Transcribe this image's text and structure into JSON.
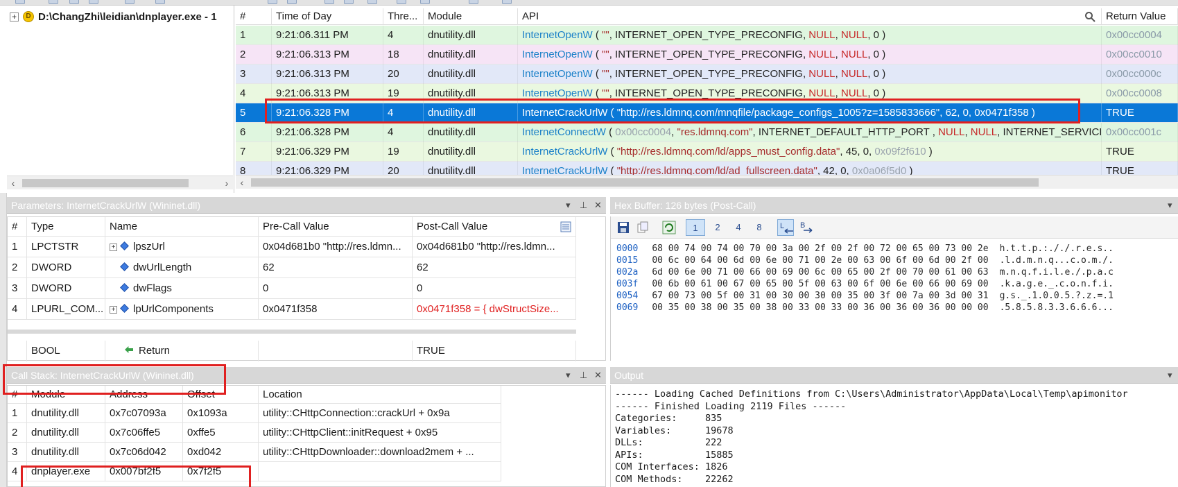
{
  "process_tree": {
    "expander": "+",
    "process_path": "D:\\ChangZhi\\leidian\\dnplayer.exe - 1"
  },
  "api_grid": {
    "columns": [
      "#",
      "Time of Day",
      "Thre...",
      "Module",
      "API",
      "Return Value"
    ],
    "rows": [
      {
        "num": "1",
        "time": "9:21:06.311 PM",
        "thread": "4",
        "module": "dnutility.dll",
        "api_fn": "InternetOpenW",
        "args": [
          [
            "c-const",
            " ( "
          ],
          [
            "c-str",
            "\"\""
          ],
          [
            "c-const",
            ", INTERNET_OPEN_TYPE_PRECONFIG, "
          ],
          [
            "c-null",
            "NULL"
          ],
          [
            "c-const",
            ", "
          ],
          [
            "c-null",
            "NULL"
          ],
          [
            "c-const",
            ", 0 )"
          ]
        ],
        "ret": "0x00cc0004",
        "bg": "#dff6df",
        "ret_dim": true
      },
      {
        "num": "2",
        "time": "9:21:06.313 PM",
        "thread": "18",
        "module": "dnutility.dll",
        "api_fn": "InternetOpenW",
        "args": [
          [
            "c-const",
            " ( "
          ],
          [
            "c-str",
            "\"\""
          ],
          [
            "c-const",
            ", INTERNET_OPEN_TYPE_PRECONFIG, "
          ],
          [
            "c-null",
            "NULL"
          ],
          [
            "c-const",
            ", "
          ],
          [
            "c-null",
            "NULL"
          ],
          [
            "c-const",
            ", 0 )"
          ]
        ],
        "ret": "0x00cc0010",
        "bg": "#f6e4f6",
        "ret_dim": true
      },
      {
        "num": "3",
        "time": "9:21:06.313 PM",
        "thread": "20",
        "module": "dnutility.dll",
        "api_fn": "InternetOpenW",
        "args": [
          [
            "c-const",
            " ( "
          ],
          [
            "c-str",
            "\"\""
          ],
          [
            "c-const",
            ", INTERNET_OPEN_TYPE_PRECONFIG, "
          ],
          [
            "c-null",
            "NULL"
          ],
          [
            "c-const",
            ", "
          ],
          [
            "c-null",
            "NULL"
          ],
          [
            "c-const",
            ", 0 )"
          ]
        ],
        "ret": "0x00cc000c",
        "bg": "#e2e8f8",
        "ret_dim": true
      },
      {
        "num": "4",
        "time": "9:21:06.313 PM",
        "thread": "19",
        "module": "dnutility.dll",
        "api_fn": "InternetOpenW",
        "args": [
          [
            "c-const",
            " ( "
          ],
          [
            "c-str",
            "\"\""
          ],
          [
            "c-const",
            ", INTERNET_OPEN_TYPE_PRECONFIG, "
          ],
          [
            "c-null",
            "NULL"
          ],
          [
            "c-const",
            ", "
          ],
          [
            "c-null",
            "NULL"
          ],
          [
            "c-const",
            ", 0 )"
          ]
        ],
        "ret": "0x00cc0008",
        "bg": "#eaf8e0",
        "ret_dim": true
      },
      {
        "num": "5",
        "time": "9:21:06.328 PM",
        "thread": "4",
        "module": "dnutility.dll",
        "api_fn": "InternetCrackUrlW",
        "args": [
          [
            "c-const",
            " ( \"http://res.ldmnq.com/mnqfile/package_configs_1005?z=1585833666\", 62, 0, 0x0471f358 )"
          ]
        ],
        "ret": "TRUE",
        "bg": "#0a78d7",
        "selected": true
      },
      {
        "num": "6",
        "time": "9:21:06.328 PM",
        "thread": "4",
        "module": "dnutility.dll",
        "api_fn": "InternetConnectW",
        "args": [
          [
            "c-const",
            " ( "
          ],
          [
            "c-num",
            "0x00cc0004"
          ],
          [
            "c-const",
            ", "
          ],
          [
            "c-str",
            "\"res.ldmnq.com\""
          ],
          [
            "c-const",
            ", INTERNET_DEFAULT_HTTP_PORT , "
          ],
          [
            "c-null",
            "NULL"
          ],
          [
            "c-const",
            ", "
          ],
          [
            "c-null",
            "NULL"
          ],
          [
            "c-const",
            ", INTERNET_SERVICE_H..."
          ]
        ],
        "ret": "0x00cc001c",
        "bg": "#dff6df",
        "ret_dim": true
      },
      {
        "num": "7",
        "time": "9:21:06.329 PM",
        "thread": "19",
        "module": "dnutility.dll",
        "api_fn": "InternetCrackUrlW",
        "args": [
          [
            "c-const",
            " ( "
          ],
          [
            "c-str",
            "\"http://res.ldmnq.com/ld/apps_must_config.data\""
          ],
          [
            "c-const",
            ", 45, 0, "
          ],
          [
            "c-num",
            "0x09f2f610"
          ],
          [
            "c-const",
            " )"
          ]
        ],
        "ret": "TRUE",
        "bg": "#eaf8e0"
      },
      {
        "num": "8",
        "time": "9:21:06.329 PM",
        "thread": "20",
        "module": "dnutility.dll",
        "api_fn": "InternetCrackUrlW",
        "args": [
          [
            "c-const",
            " ( "
          ],
          [
            "c-str",
            "\"http://res.ldmnq.com/ld/ad_fullscreen.data\""
          ],
          [
            "c-const",
            ", 42, 0, "
          ],
          [
            "c-num",
            "0x0a06f5d0"
          ],
          [
            "c-const",
            " )"
          ]
        ],
        "ret": "TRUE",
        "bg": "#e2e8f8"
      }
    ]
  },
  "params": {
    "title": "Parameters: InternetCrackUrlW (Wininet.dll)",
    "columns": [
      "#",
      "Type",
      "Name",
      "Pre-Call Value",
      "Post-Call Value"
    ],
    "rows": [
      {
        "num": "1",
        "type": "LPCTSTR",
        "name": "lpszUrl",
        "expand": true,
        "pre": "0x04d681b0 \"http://res.ldmn...",
        "post": "0x04d681b0 \"http://res.ldmn...",
        "post_red": false
      },
      {
        "num": "2",
        "type": "DWORD",
        "name": "dwUrlLength",
        "expand": false,
        "pre": "62",
        "post": "62",
        "post_red": false
      },
      {
        "num": "3",
        "type": "DWORD",
        "name": "dwFlags",
        "expand": false,
        "pre": "0",
        "post": "0",
        "post_red": false
      },
      {
        "num": "4",
        "type": "LPURL_COM...",
        "name": "lpUrlComponents",
        "expand": true,
        "pre": "0x0471f358",
        "post": "0x0471f358 = { dwStructSize...",
        "post_red": true
      }
    ],
    "return_row": {
      "type": "BOOL",
      "name": "Return",
      "post": "TRUE"
    }
  },
  "hex": {
    "title": "Hex Buffer: 126 bytes (Post-Call)",
    "tool_labels": [
      "1",
      "2",
      "4",
      "8"
    ],
    "lines": [
      {
        "off": "0000",
        "bytes": "68 00 74 00 74 00 70 00 3a 00 2f 00 2f 00 72 00 65 00 73 00 2e",
        "ascii": "h.t.t.p.:././.r.e.s.."
      },
      {
        "off": "0015",
        "bytes": "00 6c 00 64 00 6d 00 6e 00 71 00 2e 00 63 00 6f 00 6d 00 2f 00",
        "ascii": ".l.d.m.n.q...c.o.m./."
      },
      {
        "off": "002a",
        "bytes": "6d 00 6e 00 71 00 66 00 69 00 6c 00 65 00 2f 00 70 00 61 00 63",
        "ascii": "m.n.q.f.i.l.e./.p.a.c"
      },
      {
        "off": "003f",
        "bytes": "00 6b 00 61 00 67 00 65 00 5f 00 63 00 6f 00 6e 00 66 00 69 00",
        "ascii": ".k.a.g.e._.c.o.n.f.i."
      },
      {
        "off": "0054",
        "bytes": "67 00 73 00 5f 00 31 00 30 00 30 00 35 00 3f 00 7a 00 3d 00 31",
        "ascii": "g.s._.1.0.0.5.?.z.=.1"
      },
      {
        "off": "0069",
        "bytes": "00 35 00 38 00 35 00 38 00 33 00 33 00 36 00 36 00 36 00 00 00",
        "ascii": ".5.8.5.8.3.3.6.6.6..."
      }
    ]
  },
  "callstack": {
    "title": "Call Stack: InternetCrackUrlW (Wininet.dll)",
    "columns": [
      "#",
      "Module",
      "Address",
      "Offset",
      "Location"
    ],
    "rows": [
      {
        "num": "1",
        "module": "dnutility.dll",
        "address": "0x7c07093a",
        "offset": "0x1093a",
        "location": "utility::CHttpConnection::crackUrl + 0x9a"
      },
      {
        "num": "2",
        "module": "dnutility.dll",
        "address": "0x7c06ffe5",
        "offset": "0xffe5",
        "location": "utility::CHttpClient::initRequest + 0x95"
      },
      {
        "num": "3",
        "module": "dnutility.dll",
        "address": "0x7c06d042",
        "offset": "0xd042",
        "location": "utility::CHttpDownloader::download2mem + ..."
      },
      {
        "num": "4",
        "module": "dnplayer.exe",
        "address": "0x007bf2f5",
        "offset": "0x7f2f5",
        "location": ""
      }
    ]
  },
  "output": {
    "title": "Output",
    "lines": [
      "------ Loading Cached Definitions from C:\\Users\\Administrator\\AppData\\Local\\Temp\\apimonitor",
      "------ Finished Loading 2119 Files ------",
      "Categories:     835",
      "Variables:      19678",
      "DLLs:           222",
      "APIs:           15885",
      "COM Interfaces: 1826",
      "COM Methods:    22262"
    ]
  },
  "panel_controls": {
    "dropdown": "▾",
    "pin": "⊥",
    "close": "✕"
  },
  "scroll": {
    "left": "‹",
    "right": "›"
  },
  "colors": {
    "selection": "#0a78d7",
    "annotation": "#e02020",
    "function_blue": "#1a80c8",
    "string_red": "#a52a2a"
  }
}
